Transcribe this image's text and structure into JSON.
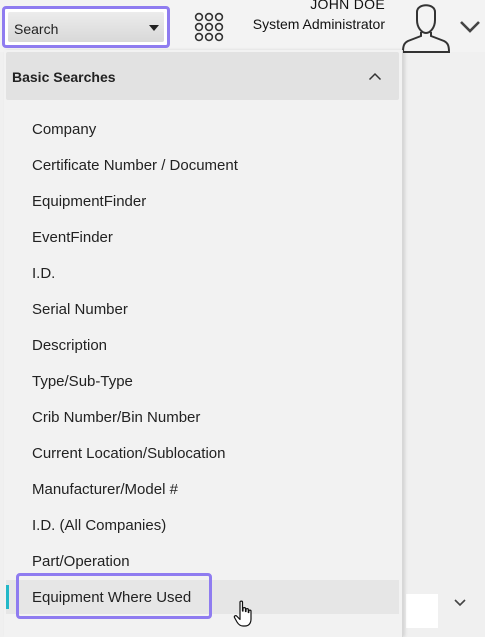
{
  "header": {
    "search_select": {
      "value": "Search"
    },
    "apps_icon": "apps-grid-icon",
    "user": {
      "name": "JOHN DOE",
      "role": "System Administrator"
    },
    "avatar_icon": "user-avatar-icon",
    "menu_icon": "chevron-down-icon"
  },
  "dropdown": {
    "group": {
      "title": "Basic Searches",
      "toggle_icon": "chevron-up-icon"
    },
    "options": [
      {
        "label": "Company"
      },
      {
        "label": "Certificate Number / Document"
      },
      {
        "label": "EquipmentFinder"
      },
      {
        "label": "EventFinder"
      },
      {
        "label": "I.D."
      },
      {
        "label": "Serial Number"
      },
      {
        "label": "Description"
      },
      {
        "label": "Type/Sub-Type"
      },
      {
        "label": "Crib Number/Bin Number"
      },
      {
        "label": "Current Location/Sublocation"
      },
      {
        "label": "Manufacturer/Model #"
      },
      {
        "label": "I.D. (All Companies)"
      },
      {
        "label": "Part/Operation"
      },
      {
        "label": "Equipment Where Used"
      }
    ],
    "hovered_option": "Equipment Where Used"
  },
  "colors": {
    "highlight_border": "#8f7cf0",
    "active_marker": "#23b8c8",
    "group_header_bg": "#e2e2e2"
  }
}
